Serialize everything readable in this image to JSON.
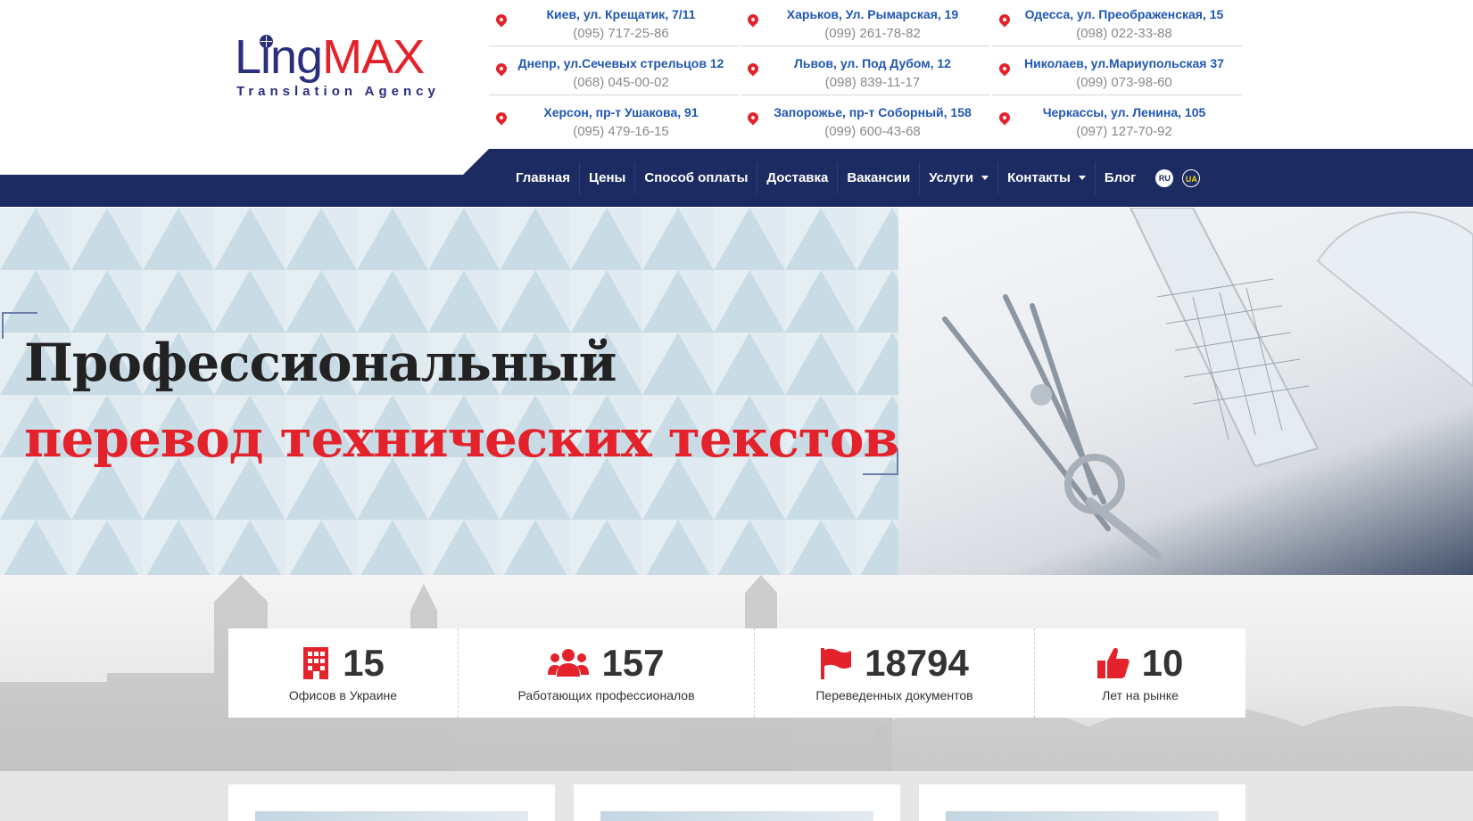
{
  "logo": {
    "ling": "Ling",
    "max": "MAX",
    "sub": "Translation Agency"
  },
  "contacts": [
    {
      "addr": "Киев, ул. Крещатик, 7/11",
      "phone": "(095) 717-25-86"
    },
    {
      "addr": "Харьков, Ул. Рымарская, 19",
      "phone": "(099) 261-78-82"
    },
    {
      "addr": "Одесса, ул. Преображенская, 15",
      "phone": "(098) 022-33-88"
    },
    {
      "addr": "Днепр, ул.Сечевых стрельцов 12",
      "phone": "(068) 045-00-02"
    },
    {
      "addr": "Львов, ул. Под Дубом, 12",
      "phone": "(098) 839-11-17"
    },
    {
      "addr": "Николаев, ул.Мариупольская 37",
      "phone": "(099) 073-98-60"
    },
    {
      "addr": "Херсон, пр-т Ушакова, 91",
      "phone": "(095) 479-16-15"
    },
    {
      "addr": "Запорожье, пр-т Соборный, 158",
      "phone": "(099) 600-43-68"
    },
    {
      "addr": "Черкассы, ул. Ленина, 105",
      "phone": "(097) 127-70-92"
    }
  ],
  "nav": {
    "items": [
      "Главная",
      "Цены",
      "Способ оплаты",
      "Доставка",
      "Вакансии",
      "Услуги",
      "Контакты",
      "Блог"
    ],
    "lang_ru": "RU",
    "lang_ua": "UA"
  },
  "hero": {
    "line1": "Профессиональный",
    "line2": "перевод технических текстов"
  },
  "stats": [
    {
      "icon": "building-icon",
      "num": "15",
      "label": "Офисов в Украине"
    },
    {
      "icon": "users-icon",
      "num": "157",
      "label": "Работающих профессионалов"
    },
    {
      "icon": "flag-icon",
      "num": "18794",
      "label": "Переведенных документов"
    },
    {
      "icon": "thumbs-up-icon",
      "num": "10",
      "label": "Лет на рынке"
    }
  ],
  "colors": {
    "brand_blue": "#1c2c62",
    "accent_red": "#e3222b",
    "link_blue": "#1f57b4"
  }
}
